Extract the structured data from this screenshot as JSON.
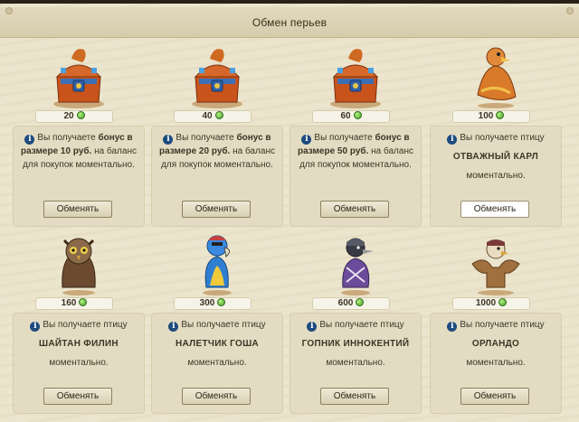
{
  "header": {
    "title": "Обмен перьев"
  },
  "offers": [
    {
      "price": "20",
      "type": "bonus",
      "line1": "Вы получаете ",
      "bold1": "бонус в",
      "bold2": "размере 10 руб.",
      "line2": " на баланс",
      "line3": "для покупок моментально.",
      "button": "Обменять",
      "art": "chest-icon"
    },
    {
      "price": "40",
      "type": "bonus",
      "line1": "Вы получаете ",
      "bold1": "бонус в",
      "bold2": "размере 20 руб.",
      "line2": " на баланс",
      "line3": "для покупок моментально.",
      "button": "Обменять",
      "art": "chest-icon"
    },
    {
      "price": "60",
      "type": "bonus",
      "line1": "Вы получаете ",
      "bold1": "бонус в",
      "bold2": "размере 50 руб.",
      "line2": " на баланс",
      "line3": "для покупок моментально.",
      "button": "Обменять",
      "art": "chest-icon"
    },
    {
      "price": "100",
      "type": "bird",
      "line1": "Вы получаете птицу",
      "name": "ОТВАЖНЫЙ КАРЛ",
      "line3": "моментально.",
      "button": "Обменять",
      "art": "bird-karl-icon"
    },
    {
      "price": "160",
      "type": "bird",
      "line1": "Вы получаете птицу",
      "name": "ШАЙТАН ФИЛИН",
      "line3": "моментально.",
      "button": "Обменять",
      "art": "owl-icon"
    },
    {
      "price": "300",
      "type": "bird",
      "line1": "Вы получаете птицу",
      "name": "НАЛЕТЧИК ГОША",
      "line3": "моментально.",
      "button": "Обменять",
      "art": "parrot-icon"
    },
    {
      "price": "600",
      "type": "bird",
      "line1": "Вы получаете птицу",
      "name": "ГОПНИК ИННОКЕНТИЙ",
      "line3": "моментально.",
      "button": "Обменять",
      "art": "crow-icon"
    },
    {
      "price": "1000",
      "type": "bird",
      "line1": "Вы получаете птицу",
      "name": "ОРЛАНДО",
      "line3": "моментально.",
      "button": "Обменять",
      "art": "eagle-icon"
    }
  ],
  "colors": {
    "background": "#ece5cd",
    "card": "#e3dcc2",
    "info": "#1e4b7f",
    "feather": "#3d9b28"
  }
}
